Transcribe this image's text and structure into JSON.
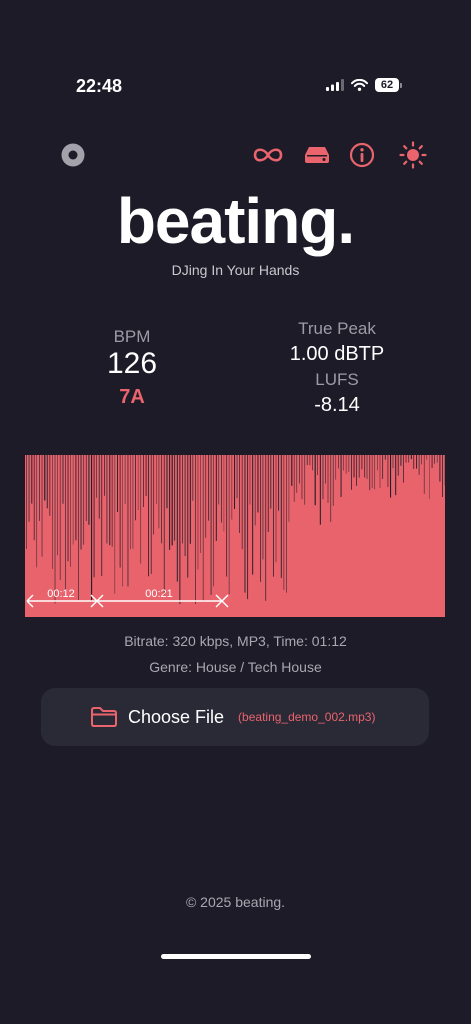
{
  "status_bar": {
    "time": "22:48",
    "battery": "62"
  },
  "toolbar": {
    "left_icon": "record-dot-icon",
    "icons": [
      "infinity-icon",
      "drive-icon",
      "info-icon",
      "sun-icon"
    ],
    "accent_color": "#e9646d"
  },
  "header": {
    "logo": "beating.",
    "tagline": "DJing In Your Hands"
  },
  "stats": {
    "bpm_label": "BPM",
    "bpm_value": "126",
    "key": "7A",
    "peak_label": "True Peak",
    "peak_value": "1.00 dBTP",
    "lufs_label": "LUFS",
    "lufs_value": "-8.14"
  },
  "waveform": {
    "color": "#e8636c",
    "markers": [
      {
        "label": "00:12"
      },
      {
        "label": "00:21"
      }
    ]
  },
  "track_info": {
    "details": "Bitrate: 320 kbps, MP3, Time: 01:12",
    "genre": "Genre: House / Tech House"
  },
  "file": {
    "button_label": "Choose File",
    "file_name": "(beating_demo_002.mp3)"
  },
  "footer": {
    "copyright": "© 2025 beating."
  }
}
